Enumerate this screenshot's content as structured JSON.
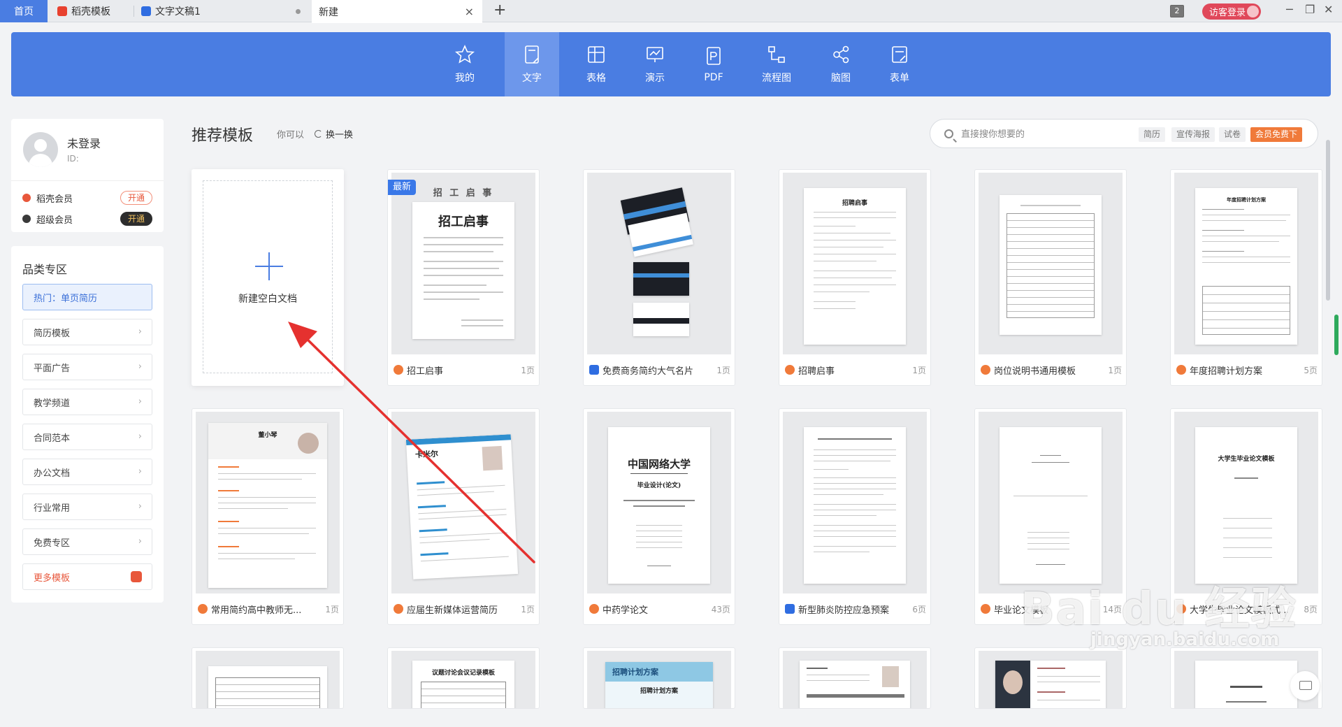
{
  "tabs": {
    "home": "首页",
    "daoke": "稻壳模板",
    "wendang": "文字文稿1",
    "xinjian": "新建",
    "close_glyph": "×",
    "new_tab_glyph": "+"
  },
  "window": {
    "badge": "2",
    "guest_login": "访客登录",
    "minimize": "─",
    "restore": "❐",
    "close": "✕"
  },
  "categories": [
    {
      "label": "我的",
      "icon": "star-icon"
    },
    {
      "label": "文字",
      "icon": "document-icon",
      "active": true
    },
    {
      "label": "表格",
      "icon": "table-icon"
    },
    {
      "label": "演示",
      "icon": "presentation-icon"
    },
    {
      "label": "PDF",
      "icon": "pdf-icon"
    },
    {
      "label": "流程图",
      "icon": "flowchart-icon"
    },
    {
      "label": "脑图",
      "icon": "mindmap-icon"
    },
    {
      "label": "表单",
      "icon": "form-icon"
    }
  ],
  "profile": {
    "name": "未登录",
    "id_label": "ID:",
    "daoke_member": "稻壳会员",
    "super_member": "超级会员",
    "open_label": "开通"
  },
  "sidebar": {
    "title": "品类专区",
    "items": [
      {
        "label": "热门：单页简历"
      },
      {
        "label": "简历模板"
      },
      {
        "label": "平面广告"
      },
      {
        "label": "教学频道"
      },
      {
        "label": "合同范本"
      },
      {
        "label": "办公文档"
      },
      {
        "label": "行业常用"
      },
      {
        "label": "免费专区"
      },
      {
        "label": "更多模板"
      }
    ],
    "chevron": "›"
  },
  "main": {
    "title": "推荐模板",
    "subtitle": "你可以",
    "swap": "换一换",
    "blank_doc": "新建空白文档",
    "newest_badge": "最新"
  },
  "search": {
    "placeholder": "直接搜你想要的",
    "tags": [
      "简历",
      "宣传海报",
      "试卷"
    ],
    "member_free": "会员免费下"
  },
  "cards": [
    {
      "name": "招工启事",
      "pages": "1页",
      "icon": "orange",
      "page_title": "招工启事",
      "header": "招 工 启 事"
    },
    {
      "name": "免费商务简约大气名片",
      "pages": "1页",
      "icon": "blue"
    },
    {
      "name": "招聘启事",
      "pages": "1页",
      "icon": "orange",
      "page_title": "招聘启事"
    },
    {
      "name": "岗位说明书通用模板",
      "pages": "1页",
      "icon": "orange"
    },
    {
      "name": "年度招聘计划方案",
      "pages": "5页",
      "icon": "orange",
      "page_title": "年度招聘计划方案"
    },
    {
      "name": "常用简约高中教师无...",
      "pages": "1页",
      "icon": "orange",
      "page_title": "董小琴"
    },
    {
      "name": "应届生新媒体运营简历",
      "pages": "1页",
      "icon": "orange",
      "page_title": "卡米尔"
    },
    {
      "name": "中药学论文",
      "pages": "43页",
      "icon": "orange",
      "page_title": "中国网络大学",
      "page_sub": "毕业设计(论文)"
    },
    {
      "name": "新型肺炎防控应急预案",
      "pages": "6页",
      "icon": "blue"
    },
    {
      "name": "毕业论文模板",
      "pages": "14页",
      "icon": "orange"
    },
    {
      "name": "大学生毕业论文模板式...",
      "pages": "8页",
      "icon": "orange",
      "page_title": "大学生毕业论文模板"
    },
    {
      "name": "",
      "pages": "",
      "icon": "none"
    },
    {
      "name": "",
      "pages": "",
      "icon": "none",
      "page_title": "议题讨论会议记录模板"
    },
    {
      "name": "",
      "pages": "",
      "icon": "none",
      "page_title": "招聘计划方案"
    },
    {
      "name": "",
      "pages": "",
      "icon": "none"
    },
    {
      "name": "",
      "pages": "",
      "icon": "none"
    },
    {
      "name": "",
      "pages": "",
      "icon": "none"
    }
  ],
  "watermark": {
    "logo": "Bai du 经验",
    "url": "jingyan.baidu.com"
  },
  "colors": {
    "accent_blue": "#4a7de2",
    "orange": "#f07a3a",
    "red_guest": "#e0485a",
    "active_tab_bg": "#6d97eb"
  }
}
